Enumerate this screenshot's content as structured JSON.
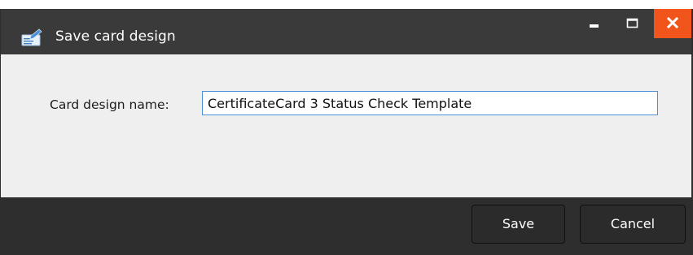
{
  "window": {
    "title": "Save card design",
    "icon": "card-design-icon",
    "controls": {
      "minimize_icon": "minimize-icon",
      "maximize_icon": "maximize-icon",
      "close_icon": "close-icon",
      "close_color": "#f2551b"
    }
  },
  "form": {
    "label": "Card design name:",
    "value": "CertificateCard 3 Status Check Template"
  },
  "buttons": {
    "save_label": "Save",
    "cancel_label": "Cancel"
  },
  "colors": {
    "titlebar": "#3a3a3a",
    "content_bg": "#efefef",
    "footer_bg": "#2e2e2e",
    "input_border": "#4a8fd9"
  }
}
